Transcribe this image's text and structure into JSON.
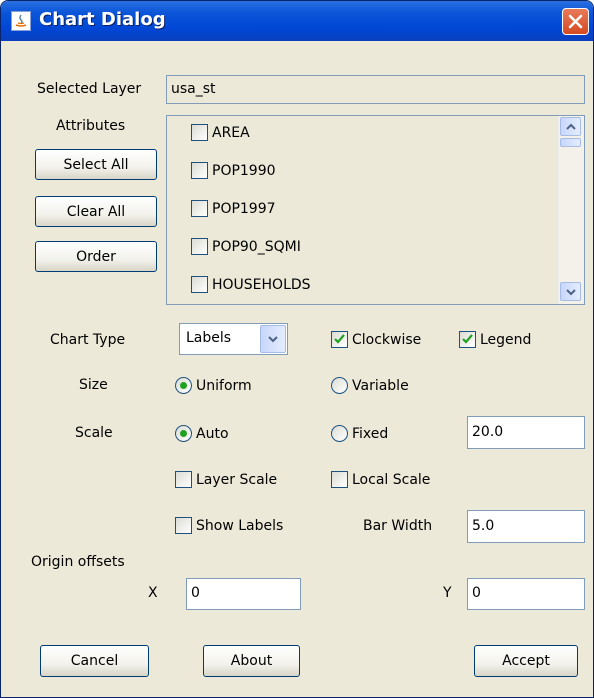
{
  "window": {
    "title": "Chart Dialog"
  },
  "selected_layer": {
    "label": "Selected Layer",
    "value": "usa_st"
  },
  "attributes": {
    "label": "Attributes",
    "select_all": "Select All",
    "clear_all": "Clear All",
    "order": "Order",
    "items": [
      {
        "label": "AREA",
        "checked": false
      },
      {
        "label": "POP1990",
        "checked": false
      },
      {
        "label": "POP1997",
        "checked": false
      },
      {
        "label": "POP90_SQMI",
        "checked": false
      },
      {
        "label": "HOUSEHOLDS",
        "checked": false
      }
    ]
  },
  "chart_type": {
    "label": "Chart Type",
    "value": "Labels"
  },
  "clockwise": {
    "label": "Clockwise",
    "checked": true
  },
  "legend": {
    "label": "Legend",
    "checked": true
  },
  "size": {
    "label": "Size",
    "uniform": "Uniform",
    "variable": "Variable",
    "selected": "Uniform"
  },
  "scale": {
    "label": "Scale",
    "auto": "Auto",
    "fixed": "Fixed",
    "selected": "Auto",
    "fixed_value": "20.0"
  },
  "layer_scale": {
    "label": "Layer Scale",
    "checked": false
  },
  "local_scale": {
    "label": "Local Scale",
    "checked": false
  },
  "show_labels": {
    "label": "Show Labels",
    "checked": false
  },
  "bar_width": {
    "label": "Bar Width",
    "value": "5.0"
  },
  "origin_offsets": {
    "label": "Origin offsets",
    "x_label": "X",
    "x_value": "0",
    "y_label": "Y",
    "y_value": "0"
  },
  "footer": {
    "cancel": "Cancel",
    "about": "About",
    "accept": "Accept"
  },
  "colors": {
    "title_bar": "#0a55d8",
    "close_button": "#d54a22",
    "background": "#ece9d8",
    "check_mark": "#21a121"
  }
}
